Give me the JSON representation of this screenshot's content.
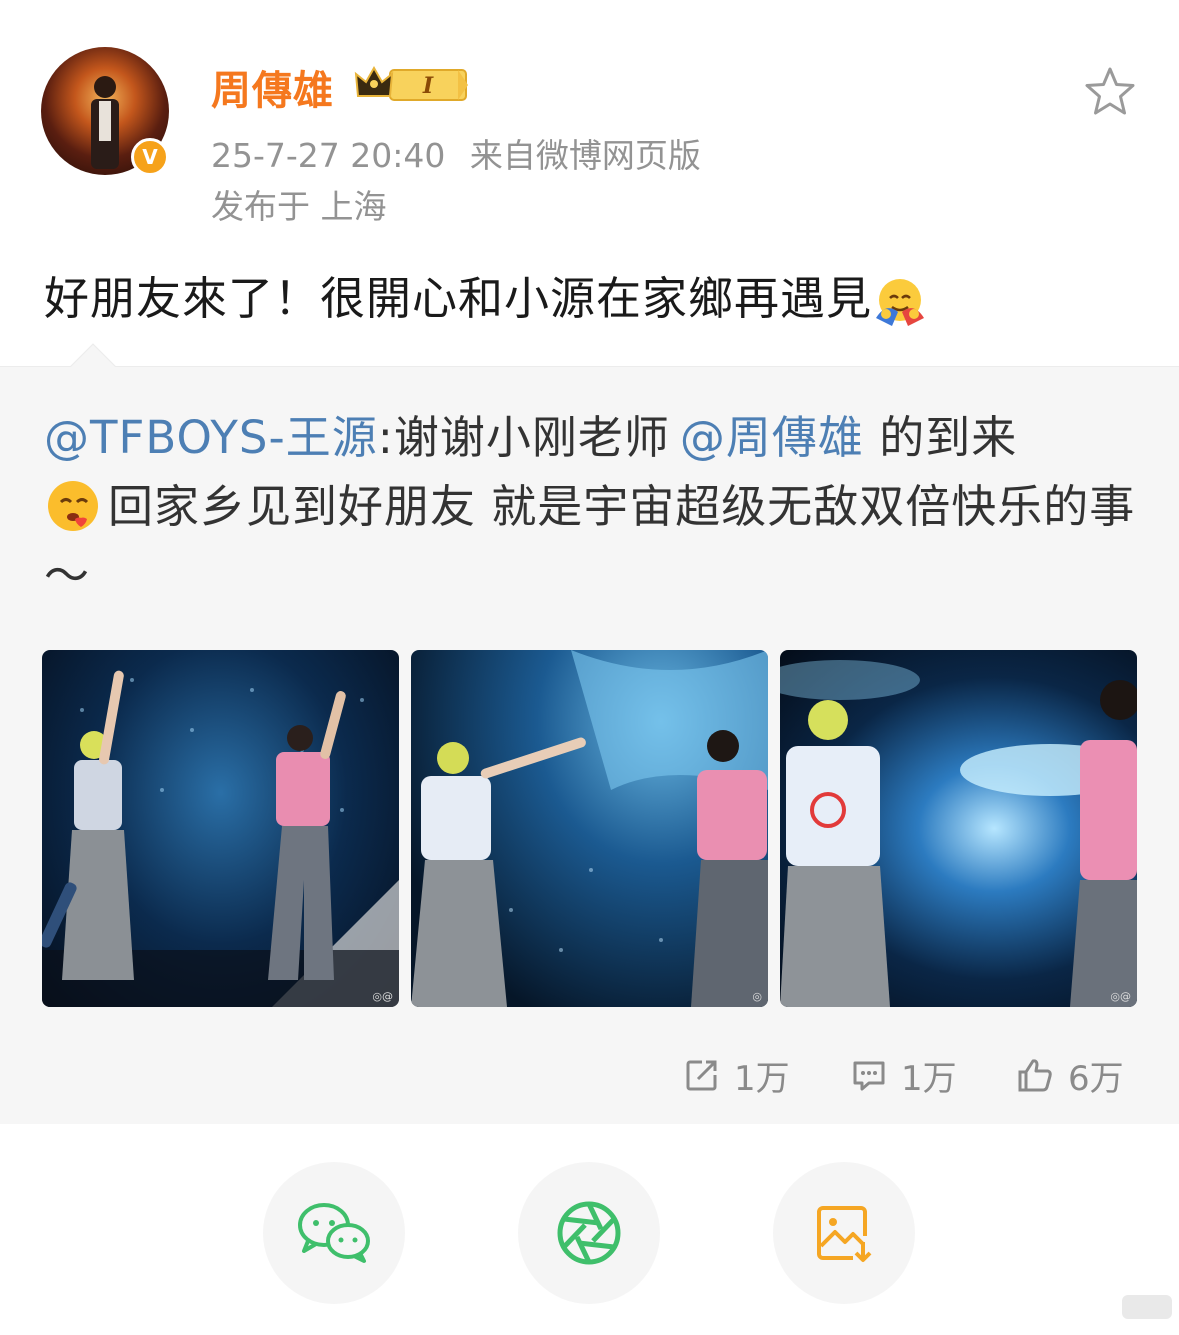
{
  "post": {
    "author": "周傳雄",
    "timestamp": "25-7-27 20:40",
    "source": "来自微博网页版",
    "location": "发布于 上海",
    "level_badge": "I",
    "text": "好朋友來了！很開心和小源在家鄉再遇見"
  },
  "repost": {
    "author_mention": "@TFBOYS-王源",
    "separator": ":",
    "text_part1": "谢谢小刚老师",
    "mention2": "@周傳雄",
    "text_part2": " 的到来",
    "text_part3": "回家乡见到好朋友 就是宇宙超级无敌双倍快乐的事～",
    "photos": [
      {
        "watermark": "◎@"
      },
      {
        "watermark": "◎"
      },
      {
        "watermark": "◎@"
      }
    ],
    "stats": {
      "reposts": "1万",
      "comments": "1万",
      "likes": "6万"
    }
  },
  "share": {
    "buttons": [
      "wechat-icon",
      "moments-icon",
      "save-image-icon"
    ]
  },
  "colors": {
    "username": "#f5781e",
    "mention": "#4d7fb4",
    "wechat": "#3fbf6b",
    "save": "#f5a623"
  }
}
